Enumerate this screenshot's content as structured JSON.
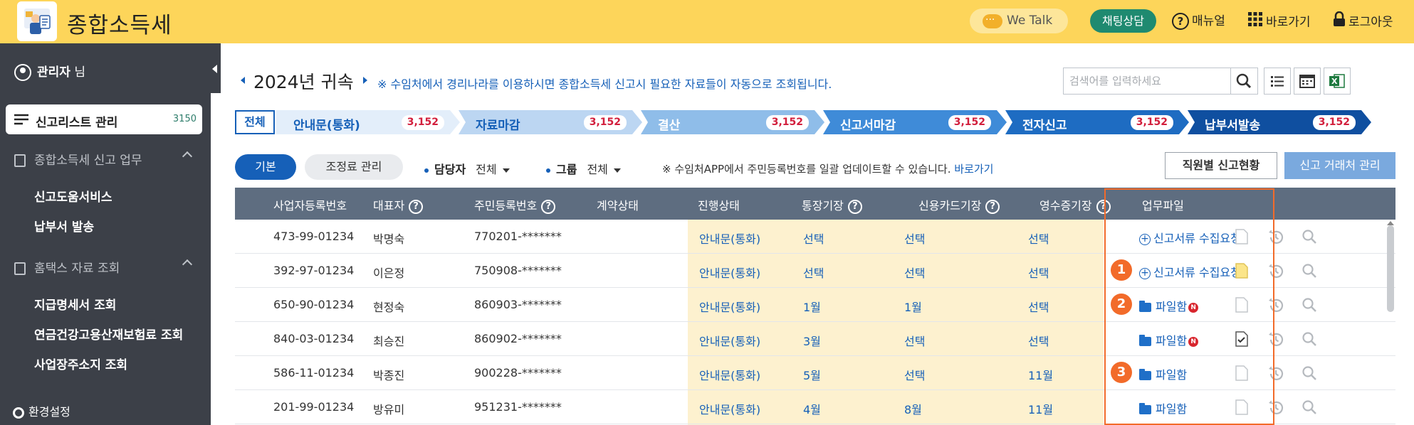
{
  "header": {
    "title": "종합소득세",
    "we_talk": "We Talk",
    "chat": "채팅상담",
    "manual": "매뉴얼",
    "shortcut": "바로가기",
    "logout": "로그아웃"
  },
  "sidebar": {
    "user_name": "관리자",
    "user_suffix": "님",
    "active_item": {
      "label": "신고리스트 관리",
      "count": "3150"
    },
    "section1": "종합소득세 신고 업무",
    "section1_items": [
      "신고도움서비스",
      "납부서 발송"
    ],
    "section2": "홈택스 자료 조회",
    "section2_items": [
      "지급명세서 조회",
      "연금건강고용산재보험료 조회",
      "사업장주소지 조회"
    ],
    "settings": "환경설정"
  },
  "main": {
    "year_title": "2024년 귀속",
    "year_note": "※ 수임처에서 경리나라를 이용하시면 종합소득세 신고시 필요한 자료들이 자동으로 조회됩니다.",
    "search_placeholder": "검색어를 입력하세요",
    "steps_all": "전체",
    "steps": [
      {
        "label": "안내문(통화)",
        "count": "3,152",
        "color": "#e3eefa",
        "text": "#1660b8"
      },
      {
        "label": "자료마감",
        "count": "3,152",
        "color": "#bcd6f2",
        "text": "#1660b8"
      },
      {
        "label": "결산",
        "count": "3,152",
        "color": "#8fbde9",
        "text": "#ffffff"
      },
      {
        "label": "신고서마감",
        "count": "3,152",
        "color": "#3f8bd8",
        "text": "#ffffff"
      },
      {
        "label": "전자신고",
        "count": "3,152",
        "color": "#1e6cc2",
        "text": "#ffffff"
      },
      {
        "label": "납부서발송",
        "count": "3,152",
        "color": "#0f4fa0",
        "text": "#ffffff"
      }
    ],
    "tabs": {
      "basic": "기본",
      "adjust": "조정료 관리"
    },
    "filter_manager_label": "담당자",
    "filter_manager_value": "전체",
    "filter_group_label": "그룹",
    "filter_group_value": "전체",
    "filter_note": "※ 수임처APP에서 주민등록번호를 일괄 업데이트할 수 있습니다.",
    "filter_link": "바로가기",
    "btn_staff": "직원별 신고현황",
    "btn_client": "신고 거래처 관리"
  },
  "table": {
    "headers": [
      "사업자등록번호",
      "대표자",
      "주민등록번호",
      "계약상태",
      "진행상태",
      "통장기장",
      "신용카드기장",
      "영수증기장",
      "업무파일"
    ],
    "rows": [
      {
        "biz": "473-99-01234",
        "rep": "박명숙",
        "rrn": "770201-*******",
        "contract": "",
        "status": "안내문(통화)",
        "bank": "선택",
        "card": "선택",
        "receipt": "선택",
        "work": "신고서류 수집요청",
        "work_type": "request",
        "marker": "",
        "new": false,
        "doc": "blank"
      },
      {
        "biz": "392-97-01234",
        "rep": "이은정",
        "rrn": "750908-*******",
        "contract": "",
        "status": "안내문(통화)",
        "bank": "선택",
        "card": "선택",
        "receipt": "선택",
        "work": "신고서류 수집요청",
        "work_type": "request",
        "marker": "1",
        "new": false,
        "doc": "yellow"
      },
      {
        "biz": "650-90-01234",
        "rep": "현정숙",
        "rrn": "860903-*******",
        "contract": "",
        "status": "안내문(통화)",
        "bank": "1월",
        "card": "1월",
        "receipt": "선택",
        "work": "파일함",
        "work_type": "folder",
        "marker": "2",
        "new": true,
        "doc": "blank"
      },
      {
        "biz": "840-03-01234",
        "rep": "최승진",
        "rrn": "860902-*******",
        "contract": "",
        "status": "안내문(통화)",
        "bank": "3월",
        "card": "선택",
        "receipt": "선택",
        "work": "파일함",
        "work_type": "folder",
        "marker": "",
        "new": true,
        "doc": "check"
      },
      {
        "biz": "586-11-01234",
        "rep": "박종진",
        "rrn": "900228-*******",
        "contract": "",
        "status": "안내문(통화)",
        "bank": "5월",
        "card": "선택",
        "receipt": "11월",
        "work": "파일함",
        "work_type": "folder",
        "marker": "3",
        "new": false,
        "doc": "blank"
      },
      {
        "biz": "201-99-01234",
        "rep": "방유미",
        "rrn": "951231-*******",
        "contract": "",
        "status": "안내문(통화)",
        "bank": "4월",
        "card": "8월",
        "receipt": "11월",
        "work": "파일함",
        "work_type": "folder",
        "marker": "",
        "new": false,
        "doc": "blank"
      }
    ]
  },
  "colors": {
    "header_bg": "#fdd55a",
    "sidebar_bg": "#3c4048",
    "accent": "#1660b8",
    "marker": "#f26b2a",
    "table_header": "#5e6d80",
    "highlight_col": "#fdf1cf"
  },
  "icons": [
    "logo-icon",
    "we-talk-icon",
    "help-icon",
    "grid-icon",
    "lock-icon",
    "user-icon",
    "list-icon",
    "document-icon",
    "chevron-up-icon",
    "gear-icon",
    "search-icon",
    "calendar-icon",
    "excel-icon",
    "history-icon",
    "folder-icon",
    "plus-circle-icon"
  ]
}
